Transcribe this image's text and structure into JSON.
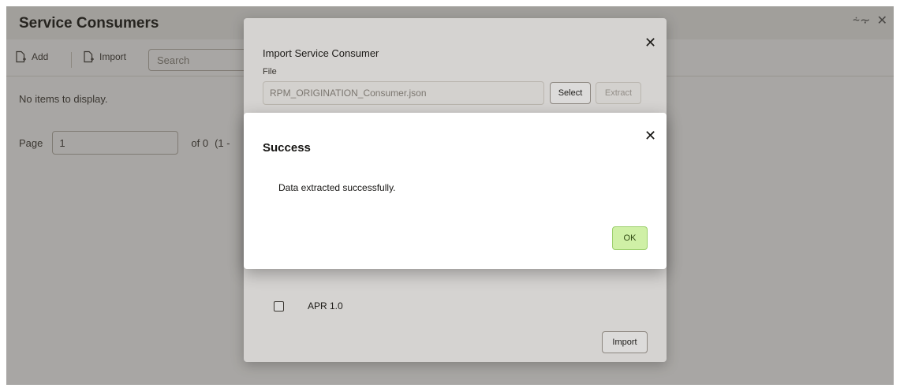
{
  "page": {
    "title": "Service Consumers",
    "header_icons": {
      "collapse": {
        "icon": "collapse-icon",
        "glyph": "⸞⸟"
      },
      "close": {
        "icon": "close-icon",
        "glyph": "✕"
      }
    }
  },
  "toolbar": {
    "add_label": "Add",
    "import_label": "Import",
    "search_placeholder": "Search"
  },
  "list": {
    "empty_text": "No items to display."
  },
  "pagination": {
    "page_label": "Page",
    "page_value": "1",
    "of_text": "of 0",
    "range_text": "(1 -"
  },
  "import_dialog": {
    "title": "Import Service Consumer",
    "close_glyph": "✕",
    "file_label": "File",
    "file_value": "RPM_ORIGINATION_Consumer.json",
    "select_label": "Select",
    "extract_label": "Extract",
    "items": [
      {
        "label": "APR 1.0",
        "checked": false
      }
    ],
    "import_label": "Import"
  },
  "success_dialog": {
    "title": "Success",
    "close_glyph": "✕",
    "message": "Data extracted successfully.",
    "ok_label": "OK"
  },
  "colors": {
    "ok_button_bg": "#cff0a6",
    "header_bg": "#f2f2f1"
  }
}
